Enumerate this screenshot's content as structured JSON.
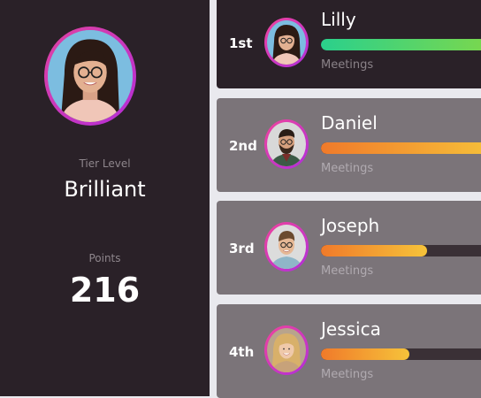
{
  "profile": {
    "tier_label": "Tier Level",
    "tier_value": "Brilliant",
    "points_label": "Points",
    "points_value": "216"
  },
  "leaderboard": [
    {
      "rank": "1st",
      "name": "Lilly",
      "caption": "Meetings",
      "progress": 1.0,
      "avatar": "woman-glasses-avatar"
    },
    {
      "rank": "2nd",
      "name": "Daniel",
      "caption": "Meetings",
      "progress": 1.0,
      "avatar": "man-beard-avatar"
    },
    {
      "rank": "3rd",
      "name": "Joseph",
      "caption": "Meetings",
      "progress": 0.6,
      "avatar": "man-glasses-avatar"
    },
    {
      "rank": "4th",
      "name": "Jessica",
      "caption": "Meetings",
      "progress": 0.5,
      "avatar": "woman-blonde-avatar"
    }
  ],
  "colors": {
    "panel_dark": "#2a2128",
    "card_grey": "#7b7479",
    "ring_pink": "#e042a0",
    "progress_green": "#2ad08c",
    "progress_orange": "#f07a2a"
  }
}
